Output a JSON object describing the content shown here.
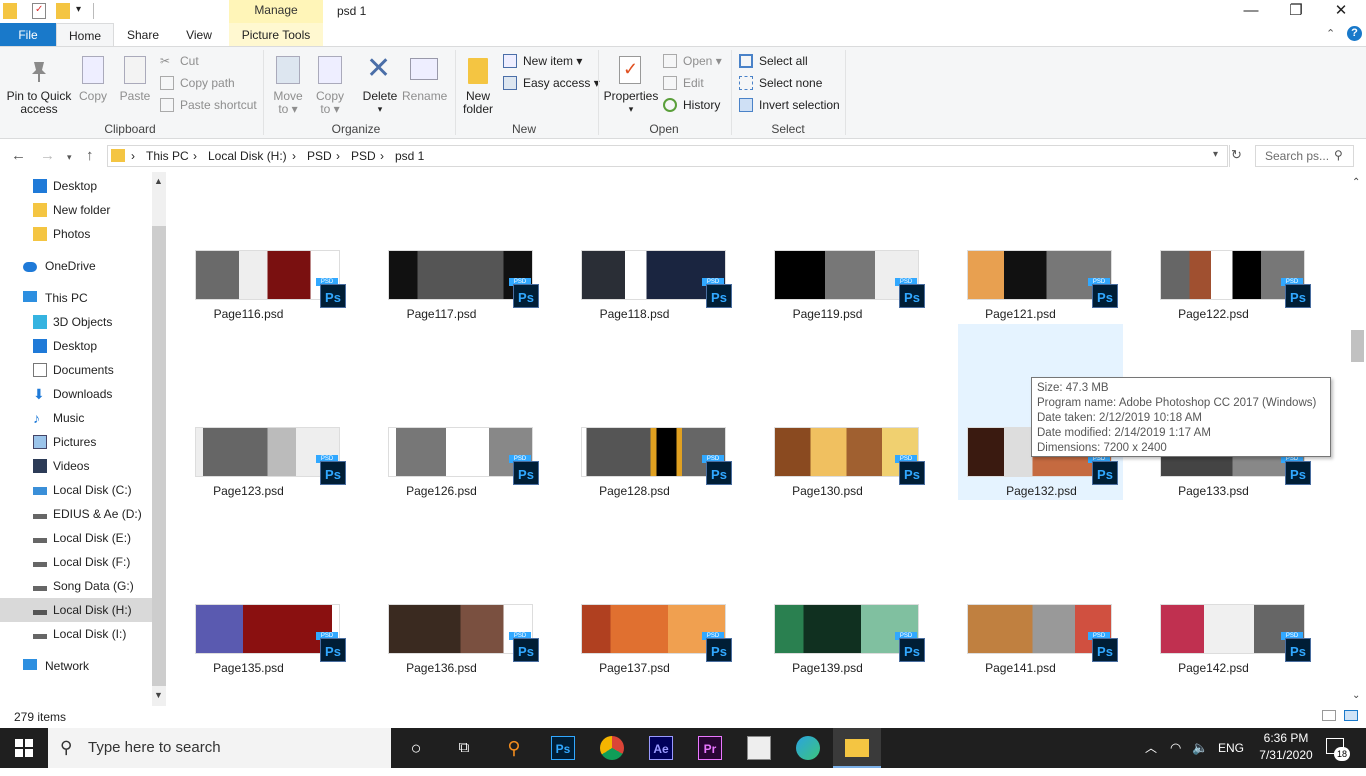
{
  "window": {
    "title": "psd 1",
    "manage_label": "Manage",
    "minimize": "—",
    "maximize": "❐",
    "close": "✕"
  },
  "tabs": {
    "file": "File",
    "home": "Home",
    "share": "Share",
    "view": "View",
    "picture_tools": "Picture Tools"
  },
  "ribbon": {
    "clipboard": {
      "label": "Clipboard",
      "pin_line1": "Pin to Quick",
      "pin_line2": "access",
      "copy": "Copy",
      "paste": "Paste",
      "cut": "Cut",
      "copy_path": "Copy path",
      "paste_shortcut": "Paste shortcut"
    },
    "organize": {
      "label": "Organize",
      "move_to_1": "Move",
      "move_to_2": "to ▾",
      "copy_to_1": "Copy",
      "copy_to_2": "to ▾",
      "delete_1": "Delete",
      "delete_2": "▾",
      "rename": "Rename"
    },
    "new": {
      "label": "New",
      "new_folder_1": "New",
      "new_folder_2": "folder",
      "new_item": "New item ▾",
      "easy_access": "Easy access ▾"
    },
    "open": {
      "label": "Open",
      "properties_1": "Properties",
      "properties_2": "▾",
      "open": "Open ▾",
      "edit": "Edit",
      "history": "History"
    },
    "select": {
      "label": "Select",
      "select_all": "Select all",
      "select_none": "Select none",
      "invert": "Invert selection"
    }
  },
  "address": {
    "crumbs": [
      "This PC",
      "Local Disk (H:)",
      "PSD",
      "PSD",
      "psd 1"
    ],
    "sep": "›",
    "search_placeholder": "Search ps..."
  },
  "nav": {
    "items": [
      "Desktop",
      "New folder",
      "Photos",
      "OneDrive",
      "This PC",
      "3D Objects",
      "Desktop",
      "Documents",
      "Downloads",
      "Music",
      "Pictures",
      "Videos",
      "Local Disk (C:)",
      "EDIUS & Ae (D:)",
      "Local Disk (E:)",
      "Local Disk (F:)",
      "Song Data (G:)",
      "Local Disk (H:)",
      "Local Disk (I:)",
      "Network"
    ],
    "selected": "Local Disk (H:)"
  },
  "files": {
    "row1": [
      "Page116.psd",
      "Page117.psd",
      "Page118.psd",
      "Page119.psd",
      "Page121.psd",
      "Page122.psd"
    ],
    "row2": [
      "Page123.psd",
      "Page126.psd",
      "Page128.psd",
      "Page130.psd",
      "Page132.psd",
      "Page133.psd"
    ],
    "row3": [
      "Page135.psd",
      "Page136.psd",
      "Page137.psd",
      "Page139.psd",
      "Page141.psd",
      "Page142.psd"
    ],
    "ps_badge": "Ps",
    "ps_tag": "PSD"
  },
  "tooltip": {
    "size": "Size: 47.3 MB",
    "program": "Program name: Adobe Photoshop CC 2017 (Windows)",
    "date_taken": "Date taken: 2/12/2019 10:18 AM",
    "date_modified": "Date modified: 2/14/2019 1:17 AM",
    "dimensions": "Dimensions: 7200 x 2400"
  },
  "status": {
    "item_count": "279 items"
  },
  "taskbar": {
    "search_placeholder": "Type here to search",
    "apps": {
      "ps": "Ps",
      "ae": "Ae",
      "pr": "Pr"
    },
    "language": "ENG",
    "time": "6:36 PM",
    "date": "7/31/2020",
    "notifications": "18"
  },
  "colors": {
    "accent": "#1979ca",
    "manage_bg": "#fff5b8",
    "hover": "#e5f3ff",
    "taskbar": "#1f1f1f"
  }
}
